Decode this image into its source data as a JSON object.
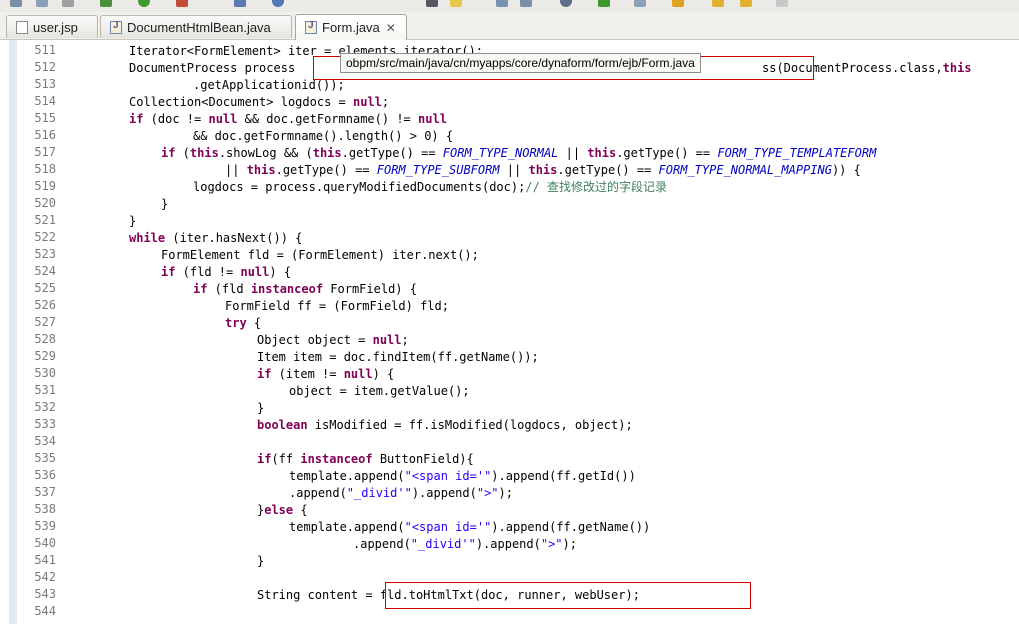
{
  "tabs": [
    {
      "label": "user.jsp",
      "icon": "jsp-file-icon",
      "active": false
    },
    {
      "label": "DocumentHtmlBean.java",
      "icon": "java-file-icon",
      "active": false
    },
    {
      "label": "Form.java",
      "icon": "java-file-icon",
      "active": true,
      "close": "✕"
    }
  ],
  "tooltip": "obpm/src/main/java/cn/myapps/core/dynaform/form/ejb/Form.java",
  "colors": {
    "keyword": "#7f0055",
    "string": "#2a00ff",
    "constant": "#0000c0",
    "comment": "#3f7f5f",
    "highlight_box": "#d10000"
  },
  "line_numbers": [
    "511",
    "512",
    "513",
    "514",
    "515",
    "516",
    "517",
    "518",
    "519",
    "520",
    "521",
    "522",
    "523",
    "524",
    "525",
    "526",
    "527",
    "528",
    "529",
    "530",
    "531",
    "532",
    "533",
    "534",
    "535",
    "536",
    "537",
    "538",
    "539",
    "540",
    "541",
    "542",
    "543",
    "544"
  ],
  "code": {
    "l511_a": "Iterator<FormElement> iter = ",
    "l511_b": "elements.iterator();",
    "l512_a": "DocumentProcess process ",
    "l512_b": "ss(DocumentProcess.class,",
    "l512_c": "this",
    "l513": ".getApplicationid());",
    "l514_a": "Collection<Document> logdocs = ",
    "l514_kw": "null",
    "l514_b": ";",
    "l515_if": "if",
    "l515_a": " (doc != ",
    "l515_null1": "null",
    "l515_b": " && doc.getFormname() != ",
    "l515_null2": "null",
    "l516": "&& doc.getFormname().length() > 0) {",
    "l517_if": "if",
    "l517_a": " (",
    "l517_this1": "this",
    "l517_b": ".showLog && (",
    "l517_this2": "this",
    "l517_c": ".getType() == ",
    "l517_c1": "FORM_TYPE_NORMAL",
    "l517_d": " || ",
    "l517_this3": "this",
    "l517_e": ".getType() == ",
    "l517_c2": "FORM_TYPE_TEMPLATEFORM",
    "l518_a": "|| ",
    "l518_this1": "this",
    "l518_b": ".getType() == ",
    "l518_c1": "FORM_TYPE_SUBFORM",
    "l518_d": " || ",
    "l518_this2": "this",
    "l518_e": ".getType() == ",
    "l518_c2": "FORM_TYPE_NORMAL_MAPPING",
    "l518_f": ")) {",
    "l519_a": "logdocs = process.queryModifiedDocuments(doc);",
    "l519_cm": "// 查找修改过的字段记录",
    "l520": "}",
    "l521": "}",
    "l522_kw": "while",
    "l522_a": " (iter.hasNext()) {",
    "l523": "FormElement fld = (FormElement) iter.next();",
    "l524_if": "if",
    "l524_a": " (fld != ",
    "l524_null": "null",
    "l524_b": ") {",
    "l525_if": "if",
    "l525_a": " (fld ",
    "l525_kw": "instanceof",
    "l525_b": " FormField) {",
    "l526": "FormField ff = (FormField) fld;",
    "l527_kw": "try",
    "l527_a": " {",
    "l528_a": "Object object = ",
    "l528_null": "null",
    "l528_b": ";",
    "l529": "Item item = doc.findItem(ff.getName());",
    "l530_if": "if",
    "l530_a": " (item != ",
    "l530_null": "null",
    "l530_b": ") {",
    "l531": "object = item.getValue();",
    "l532": "}",
    "l533_kw": "boolean",
    "l533_a": " isModified = ff.isModified(logdocs, object);",
    "l535_if": "if",
    "l535_a": "(ff ",
    "l535_kw": "instanceof",
    "l535_b": " ButtonField){",
    "l536_a": "template.append(",
    "l536_s": "\"<span id='\"",
    "l536_b": ").append(ff.getId())",
    "l537_a": ".append(",
    "l537_s1": "\"_divid'\"",
    "l537_b": ").append(",
    "l537_s2": "\">\"",
    "l537_c": ");",
    "l538_a": "}",
    "l538_kw": "else",
    "l538_b": " {",
    "l539_a": "template.append(",
    "l539_s": "\"<span id='\"",
    "l539_b": ").append(ff.getName())",
    "l540_a": ".append(",
    "l540_s1": "\"_divid'\"",
    "l540_b": ").append(",
    "l540_s2": "\">\"",
    "l540_c": ");",
    "l541": "}",
    "l543_a": "String content = ",
    "l543_b": "fld.toHtmlTxt(doc, runner, webUser);"
  }
}
